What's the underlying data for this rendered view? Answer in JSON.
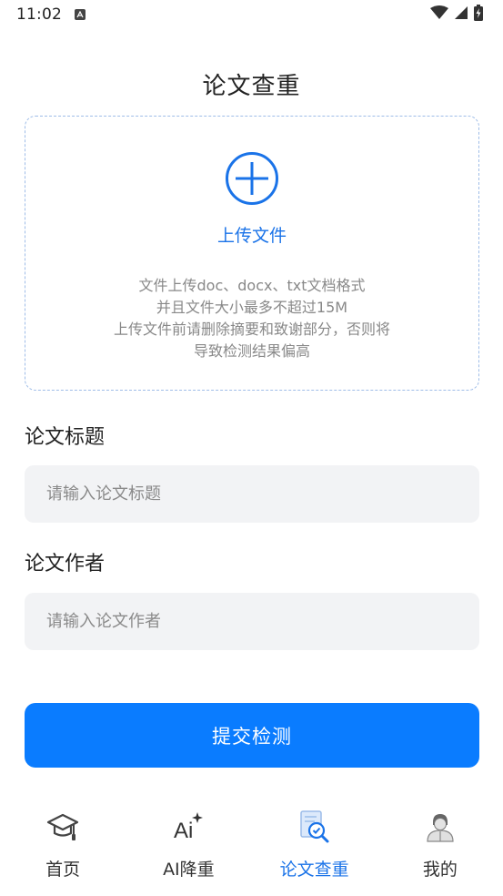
{
  "status_bar": {
    "time": "11:02",
    "icons": [
      "notification-a-icon",
      "wifi-icon",
      "signal-icon",
      "battery-charging-icon"
    ]
  },
  "page": {
    "title": "论文查重"
  },
  "upload": {
    "icon": "plus-circle-icon",
    "label": "上传文件",
    "hint_lines": [
      "文件上传doc、docx、txt文档格式",
      "并且文件大小最多不超过15M",
      "上传文件前请删除摘要和致谢部分，否则将",
      "导致检测结果偏高"
    ]
  },
  "form": {
    "title_label": "论文标题",
    "title_placeholder": "请输入论文标题",
    "title_value": "",
    "author_label": "论文作者",
    "author_placeholder": "请输入论文作者",
    "author_value": "",
    "submit_label": "提交检测"
  },
  "nav": {
    "items": [
      {
        "label": "首页",
        "icon": "graduation-cap-icon",
        "active": false
      },
      {
        "label": "AI降重",
        "icon": "ai-sparkle-icon",
        "active": false
      },
      {
        "label": "论文查重",
        "icon": "document-check-icon",
        "active": true
      },
      {
        "label": "我的",
        "icon": "user-avatar-icon",
        "active": false
      }
    ]
  },
  "colors": {
    "accent": "#1a73e8",
    "button": "#0a7cff",
    "input_bg": "#f2f3f5",
    "dashed_border": "#9fbde8"
  }
}
